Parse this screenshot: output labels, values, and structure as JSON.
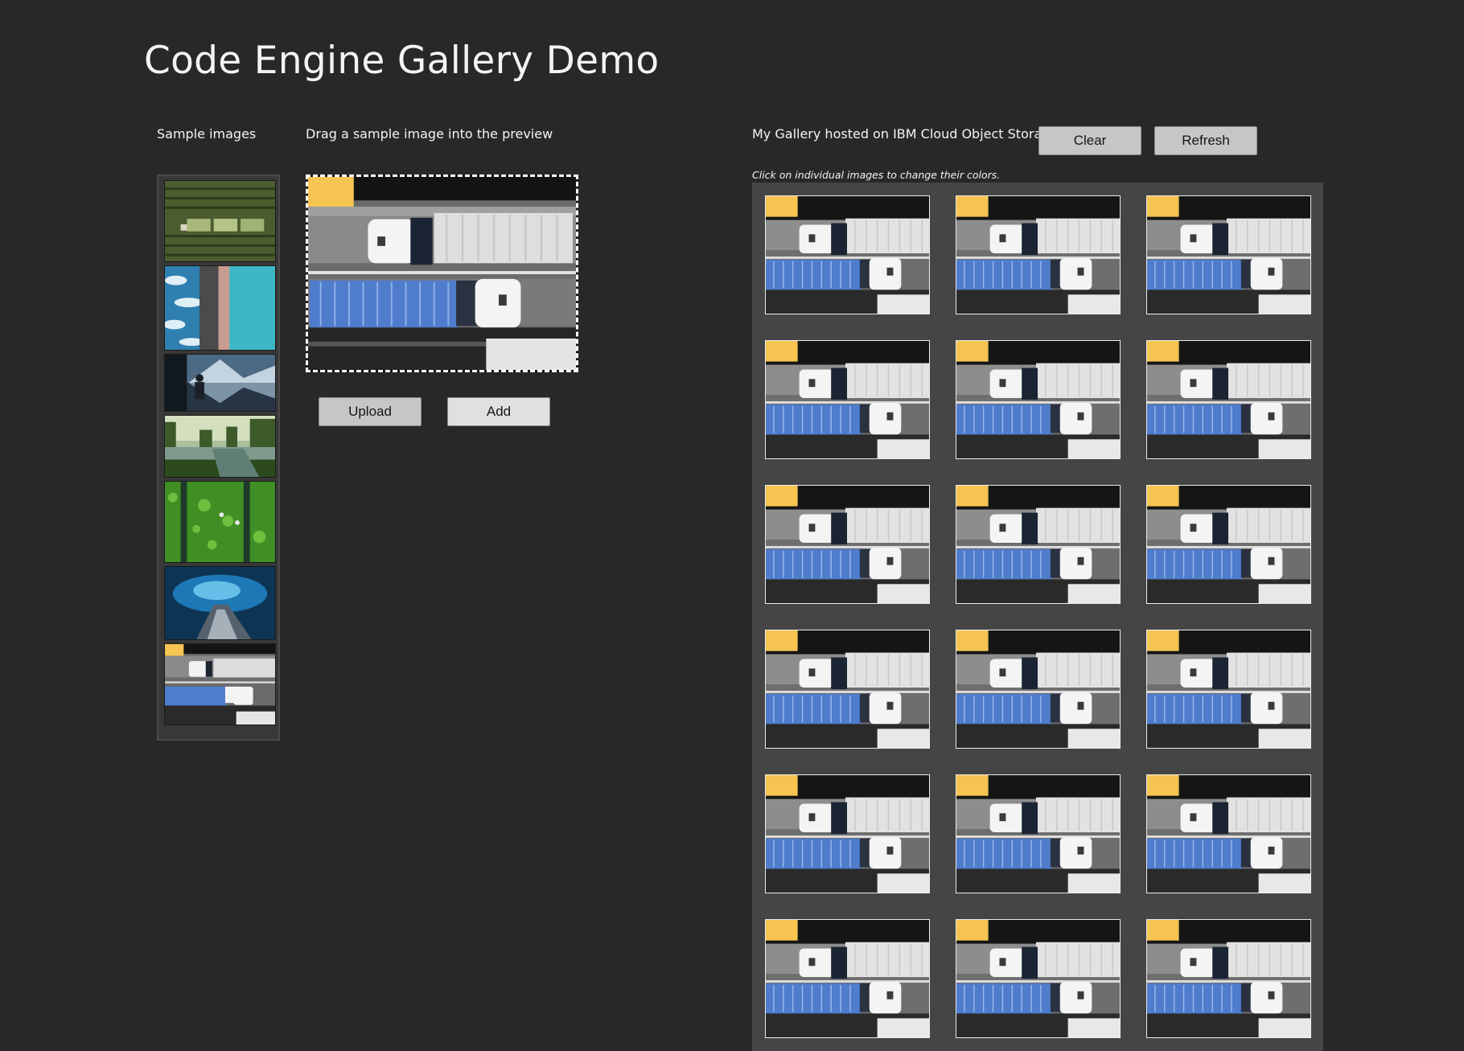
{
  "page_title": "Code Engine Gallery Demo",
  "samples": {
    "heading": "Sample images",
    "items": [
      {
        "name": "sample-image-aerial-field",
        "subject": "aerial farm field with rows of crops"
      },
      {
        "name": "sample-image-coastline",
        "subject": "aerial coastline with waves and road"
      },
      {
        "name": "sample-image-mountain-lake",
        "subject": "person viewing mountain lake"
      },
      {
        "name": "sample-image-forest-river",
        "subject": "river flowing through forest"
      },
      {
        "name": "sample-image-green-rows",
        "subject": "aerial green crop rows with paths"
      },
      {
        "name": "sample-image-ice-cave",
        "subject": "blue ice cave"
      },
      {
        "name": "sample-image-trucks",
        "subject": "two trucks on highway from above"
      }
    ]
  },
  "preview": {
    "heading": "Drag a sample image into the preview",
    "subject": "two trucks on highway from above"
  },
  "actions": {
    "upload_label": "Upload",
    "add_label": "Add"
  },
  "gallery": {
    "heading": "My Gallery hosted on IBM Cloud Object Storage",
    "clear_label": "Clear",
    "refresh_label": "Refresh",
    "hint": "Click on individual images to change their colors.",
    "item_count": 18,
    "item_subject": "two trucks on highway from above"
  },
  "colors": {
    "background": "#282828",
    "gallery_panel": "#454545",
    "button": "#c6c6c6",
    "truck_container": "#4f7ccc",
    "accent_yellow": "#f5c451"
  }
}
